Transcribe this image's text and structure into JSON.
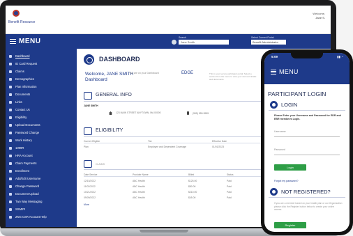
{
  "app": {
    "logo_text": "Benefit Resource",
    "user_welcome": "Welcome,",
    "user_name": "Jane S."
  },
  "nav": {
    "menu_label": "MENU",
    "search_label": "Search",
    "search_value": "Jane Smith",
    "portal_label": "Select Current Portal",
    "portal_value": "Benefit Administrator"
  },
  "sidebar": {
    "items": [
      {
        "label": "Dashboard"
      },
      {
        "label": "ID Card Request"
      },
      {
        "label": "Claims"
      },
      {
        "label": "Demographics"
      },
      {
        "label": "Plan Information"
      },
      {
        "label": "Documents"
      },
      {
        "label": "Links"
      },
      {
        "label": "Contact Us"
      },
      {
        "label": "Eligibility"
      },
      {
        "label": "Upload Documents"
      },
      {
        "label": "Password Change"
      },
      {
        "label": "Work History"
      },
      {
        "label": "1099R"
      },
      {
        "label": "HRA Account"
      },
      {
        "label": "Claim Payments"
      },
      {
        "label": "Enrollment"
      },
      {
        "label": "Add/Edit Username"
      },
      {
        "label": "Change Password"
      },
      {
        "label": "Document Upload"
      },
      {
        "label": "Two Way Messaging"
      },
      {
        "label": "SSMIPI"
      },
      {
        "label": "ZNG CSR Account Help"
      }
    ]
  },
  "dashboard": {
    "title": "DASHBOARD",
    "welcome": "Welcome, JANE SMITH",
    "welcome_dashboard": "Dashboard",
    "welcome_note": "You are on your Dashboard",
    "edge_label": "EDGE",
    "fine_print": "This is your secure participant portal. Select a section from the menu to view your account details and documents.",
    "general_info_title": "GENERAL INFO",
    "person_name": "JANE SMITH",
    "address": "123 MAIN STREET ANYTOWN, MA 00000",
    "phone": "(555) 555-5555",
    "eligibility_title": "ELIGIBILITY",
    "elig_cols": [
      "Current Eligible",
      "Tier",
      "Effective Date"
    ],
    "elig_row": [
      "Plan",
      "Employee and Dependent Coverage",
      "01/01/2023"
    ],
    "claims_title": "CLAIMS",
    "claims_cols": [
      "Date Service",
      "Provider Name",
      "Billed",
      "Status"
    ],
    "claims_rows": [
      [
        "12/15/2022",
        "ABC Health",
        "$125.00",
        "Paid"
      ],
      [
        "11/02/2022",
        "ABC Health",
        "$80.00",
        "Paid"
      ],
      [
        "10/21/2022",
        "ABC Health",
        "$210.00",
        "Paid"
      ],
      [
        "09/09/2022",
        "ABC Health",
        "$45.00",
        "Paid"
      ]
    ],
    "claims_more": "More"
  },
  "phone": {
    "time": "5:09",
    "signal": "▮▮ ◔",
    "menu_label": "MENU",
    "login_title": "PARTICIPANT LOGIN",
    "login_label": "LOGIN",
    "instructions": "Please Enter your Username and Password for EDR and EBR member/s Login.",
    "username_label": "Username",
    "password_label": "Password",
    "login_button": "Login",
    "forgot": "Forgot my password?",
    "not_registered_title": "NOT REGISTERED?",
    "not_registered_text": "If you are a member based on your health plan or our Organization please click the Register button below to create your online access.",
    "register_button": "Register"
  }
}
